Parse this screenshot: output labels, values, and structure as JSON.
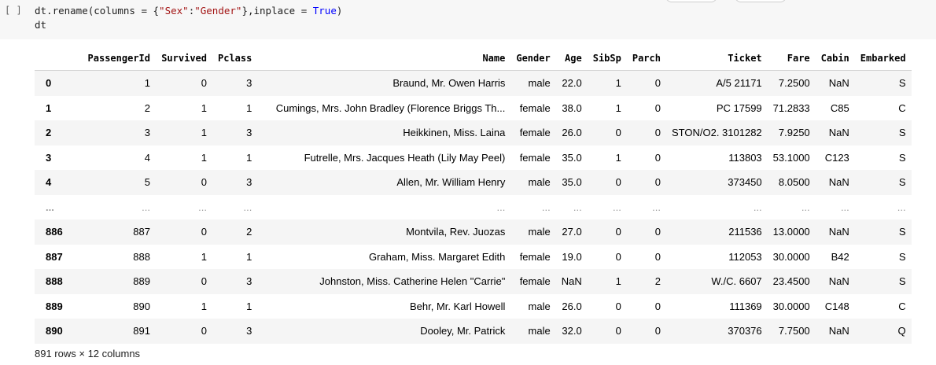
{
  "cell": {
    "run_indicator": "[ ]",
    "code_line1_pre": "dt.rename(columns = {",
    "code_line1_str1": "\"Sex\"",
    "code_line1_colon": ":",
    "code_line1_str2": "\"Gender\"",
    "code_line1_mid": "},inplace = ",
    "code_line1_kw": "True",
    "code_line1_end": ")",
    "code_line2": "dt"
  },
  "table": {
    "columns": [
      "",
      "PassengerId",
      "Survived",
      "Pclass",
      "Name",
      "Gender",
      "Age",
      "SibSp",
      "Parch",
      "Ticket",
      "Fare",
      "Cabin",
      "Embarked"
    ],
    "rows": [
      [
        "0",
        "1",
        "0",
        "3",
        "Braund, Mr. Owen Harris",
        "male",
        "22.0",
        "1",
        "0",
        "A/5 21171",
        "7.2500",
        "NaN",
        "S"
      ],
      [
        "1",
        "2",
        "1",
        "1",
        "Cumings, Mrs. John Bradley (Florence Briggs Th...",
        "female",
        "38.0",
        "1",
        "0",
        "PC 17599",
        "71.2833",
        "C85",
        "C"
      ],
      [
        "2",
        "3",
        "1",
        "3",
        "Heikkinen, Miss. Laina",
        "female",
        "26.0",
        "0",
        "0",
        "STON/O2. 3101282",
        "7.9250",
        "NaN",
        "S"
      ],
      [
        "3",
        "4",
        "1",
        "1",
        "Futrelle, Mrs. Jacques Heath (Lily May Peel)",
        "female",
        "35.0",
        "1",
        "0",
        "113803",
        "53.1000",
        "C123",
        "S"
      ],
      [
        "4",
        "5",
        "0",
        "3",
        "Allen, Mr. William Henry",
        "male",
        "35.0",
        "0",
        "0",
        "373450",
        "8.0500",
        "NaN",
        "S"
      ],
      [
        "...",
        "...",
        "...",
        "...",
        "...",
        "...",
        "...",
        "...",
        "...",
        "...",
        "...",
        "...",
        "..."
      ],
      [
        "886",
        "887",
        "0",
        "2",
        "Montvila, Rev. Juozas",
        "male",
        "27.0",
        "0",
        "0",
        "211536",
        "13.0000",
        "NaN",
        "S"
      ],
      [
        "887",
        "888",
        "1",
        "1",
        "Graham, Miss. Margaret Edith",
        "female",
        "19.0",
        "0",
        "0",
        "112053",
        "30.0000",
        "B42",
        "S"
      ],
      [
        "888",
        "889",
        "0",
        "3",
        "Johnston, Miss. Catherine Helen \"Carrie\"",
        "female",
        "NaN",
        "1",
        "2",
        "W./C. 6607",
        "23.4500",
        "NaN",
        "S"
      ],
      [
        "889",
        "890",
        "1",
        "1",
        "Behr, Mr. Karl Howell",
        "male",
        "26.0",
        "0",
        "0",
        "111369",
        "30.0000",
        "C148",
        "C"
      ],
      [
        "890",
        "891",
        "0",
        "3",
        "Dooley, Mr. Patrick",
        "male",
        "32.0",
        "0",
        "0",
        "370376",
        "7.7500",
        "NaN",
        "Q"
      ]
    ],
    "footer": "891 rows × 12 columns"
  }
}
